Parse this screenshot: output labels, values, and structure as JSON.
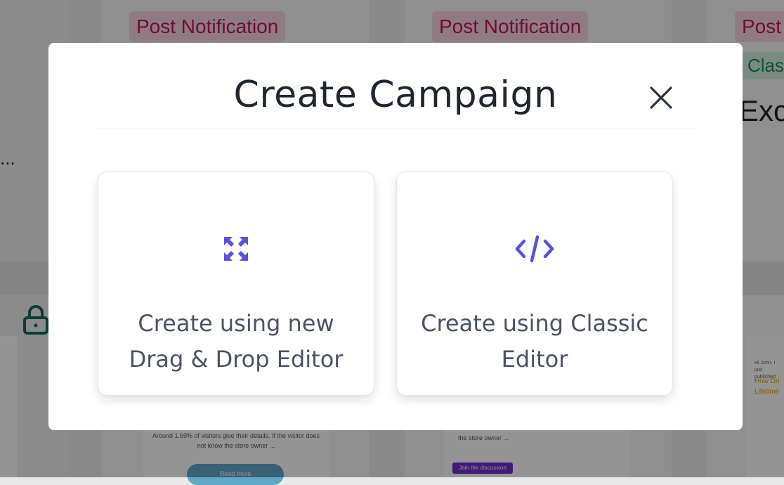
{
  "background": {
    "tags": [
      "Post Notification",
      "Post Notification",
      "Post"
    ],
    "classic_tag": "Class",
    "heading_partial": "Exci",
    "ellipsis": "...",
    "mini_text_1": "Around 1.69% of visitors give their details. If the visitor does not know the store owner ...",
    "mini_text_2": "the store owner ...",
    "mini_button_1": "Read more",
    "mini_button_2": "Join the discussion",
    "mini_greeting": "Hi John, I just published",
    "mini_link": "How Dri Lifetime"
  },
  "modal": {
    "title": "Create Campaign",
    "close_icon": "close-icon",
    "options": [
      {
        "icon": "expand-arrows-icon",
        "label": "Create using new Drag & Drop Editor"
      },
      {
        "icon": "code-icon",
        "label": "Create using Classic Editor"
      }
    ]
  },
  "colors": {
    "accent": "#5b4fe0",
    "title": "#1f2630",
    "label": "#4b5260",
    "tag_text": "#c2185b",
    "tag_bg": "#f7d6e2"
  }
}
